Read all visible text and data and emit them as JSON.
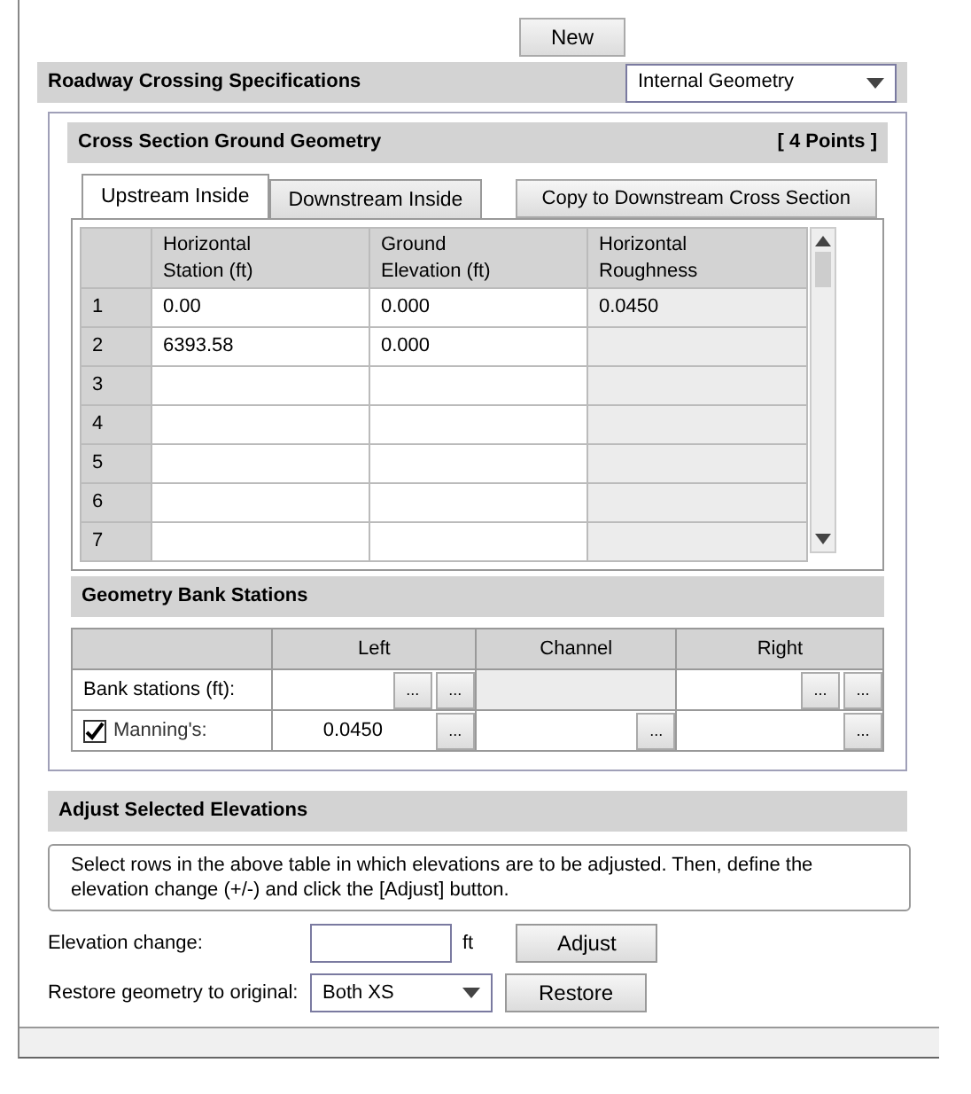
{
  "toolbar": {
    "buttons": [
      {
        "label": "New"
      }
    ]
  },
  "crossing": {
    "title": "Roadway Crossing Specifications",
    "dropdown": {
      "value": "Internal Geometry"
    }
  },
  "ground_geometry": {
    "title": "Cross Section Ground Geometry",
    "point_count": "[ 4 Points ]",
    "tabs": [
      {
        "label": "Upstream Inside",
        "selected": true
      },
      {
        "label": "Downstream Inside",
        "selected": false
      }
    ],
    "copy_button": "Copy to Downstream Cross Section",
    "table": {
      "columns": [
        "Horizontal Station (ft)",
        "Ground Elevation (ft)",
        "Horizontal Roughness"
      ],
      "rows": [
        {
          "number": "1",
          "cells": [
            "0.00",
            "0.000",
            "0.0450"
          ]
        },
        {
          "number": "2",
          "cells": [
            "6393.58",
            "0.000"
          ]
        },
        {
          "number": "3"
        },
        {
          "number": "4"
        },
        {
          "number": "5"
        },
        {
          "number": "6"
        },
        {
          "number": "7"
        }
      ]
    }
  },
  "bank_stations": {
    "title": "Geometry Bank Stations",
    "columns": [
      "Left",
      "Channel",
      "Right"
    ],
    "rows": [
      {
        "label": "Bank stations (ft):",
        "cells": [
          {
            "buttons": [
              "...",
              "..."
            ]
          },
          {
            "disabled": true
          },
          {
            "buttons": [
              "...",
              "..."
            ]
          }
        ]
      },
      {
        "label": "Manning's:",
        "checked": true,
        "cells": [
          {
            "value": "0.0450",
            "buttons": [
              "..."
            ]
          },
          {
            "buttons": [
              "..."
            ]
          },
          {
            "buttons": [
              "..."
            ]
          }
        ]
      }
    ]
  },
  "adjust": {
    "title": "Adjust Selected Elevations",
    "info": "Select rows in the above table in which elevations are to be adjusted. Then, define the elevation change (+/-) and click the [Adjust] button.",
    "elevation_label": "Elevation change:",
    "unit": "ft",
    "adjust_button": "Adjust",
    "restore_label": "Restore geometry to original:",
    "restore_dropdown": {
      "value": "Both XS"
    },
    "restore_button": "Restore"
  }
}
